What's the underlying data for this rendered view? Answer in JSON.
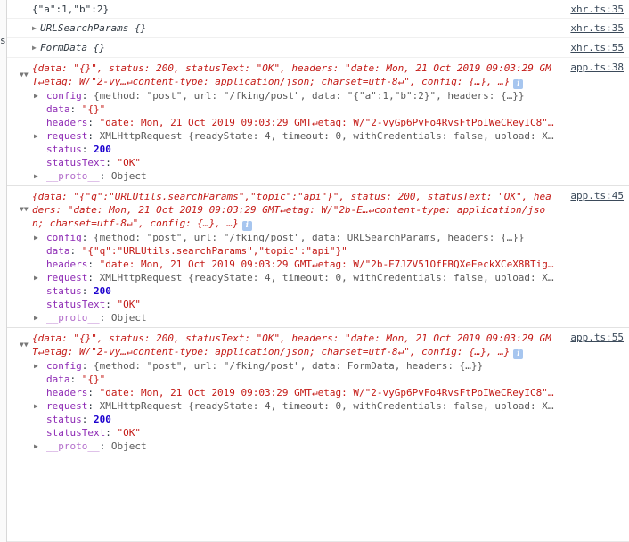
{
  "console": {
    "gutter_fragment": "s",
    "messages": [
      {
        "kind": "plain",
        "text": "{\"a\":1,\"b\":2}",
        "source": "xhr.ts:35"
      },
      {
        "kind": "collapsed-object",
        "text": "URLSearchParams {}",
        "source": "xhr.ts:35"
      },
      {
        "kind": "collapsed-object",
        "text": "FormData {}",
        "source": "xhr.ts:55"
      }
    ],
    "groups": [
      {
        "source": "app.ts:38",
        "preview_line1": "{data: \"{}\", status: 200, statusText: \"OK\", headers: \"date: Mon, 21 Oct 2019 09:03:29 GM",
        "preview_line2": "T↵etag: W/\"2-vy…↵content-type: application/json; charset=utf-8↵\", config: {…}, …}",
        "info_icon": "i",
        "props": [
          {
            "expandable": true,
            "name": "config",
            "sep": ": ",
            "value": "{method: \"post\", url: \"/fking/post\", data: \"{\"a\":1,\"b\":2}\", headers: {…}}",
            "type": "object-preview"
          },
          {
            "expandable": false,
            "name": "data",
            "sep": ": ",
            "value": "\"{}\"",
            "type": "string"
          },
          {
            "expandable": false,
            "name": "headers",
            "sep": ": ",
            "value": "\"date: Mon, 21 Oct 2019 09:03:29 GMT↵etag: W/\"2-vyGp6PvFo4RvsFtPoIWeCReyIC8\"…",
            "type": "string"
          },
          {
            "expandable": true,
            "name": "request",
            "sep": ": ",
            "value": "XMLHttpRequest {readyState: 4, timeout: 0, withCredentials: false, upload: X…",
            "type": "xhr-preview"
          },
          {
            "expandable": false,
            "name": "status",
            "sep": ": ",
            "value": "200",
            "type": "number"
          },
          {
            "expandable": false,
            "name": "statusText",
            "sep": ": ",
            "value": "\"OK\"",
            "type": "string"
          },
          {
            "expandable": true,
            "name": "__proto__",
            "sep": ": ",
            "value": "Object",
            "type": "proto"
          }
        ]
      },
      {
        "source": "app.ts:45",
        "preview_line1": "{data: \"{\"q\":\"URLUtils.searchParams\",\"topic\":\"api\"}\", status: 200, statusText: \"OK\", hea",
        "preview_line2": "ders: \"date: Mon, 21 Oct 2019 09:03:29 GMT↵etag: W/\"2b-E…↵content-type: application/jso",
        "preview_line3": "n; charset=utf-8↵\", config: {…}, …}",
        "info_icon": "i",
        "props": [
          {
            "expandable": true,
            "name": "config",
            "sep": ": ",
            "value": "{method: \"post\", url: \"/fking/post\", data: URLSearchParams, headers: {…}}",
            "type": "object-preview"
          },
          {
            "expandable": false,
            "name": "data",
            "sep": ": ",
            "value": "\"{\"q\":\"URLUtils.searchParams\",\"topic\":\"api\"}\"",
            "type": "string"
          },
          {
            "expandable": false,
            "name": "headers",
            "sep": ": ",
            "value": "\"date: Mon, 21 Oct 2019 09:03:29 GMT↵etag: W/\"2b-E7JZV51OfFBQXeEeckXCeX8BTig…",
            "type": "string"
          },
          {
            "expandable": true,
            "name": "request",
            "sep": ": ",
            "value": "XMLHttpRequest {readyState: 4, timeout: 0, withCredentials: false, upload: X…",
            "type": "xhr-preview"
          },
          {
            "expandable": false,
            "name": "status",
            "sep": ": ",
            "value": "200",
            "type": "number"
          },
          {
            "expandable": false,
            "name": "statusText",
            "sep": ": ",
            "value": "\"OK\"",
            "type": "string"
          },
          {
            "expandable": true,
            "name": "__proto__",
            "sep": ": ",
            "value": "Object",
            "type": "proto"
          }
        ]
      },
      {
        "source": "app.ts:55",
        "preview_line1": "{data: \"{}\", status: 200, statusText: \"OK\", headers: \"date: Mon, 21 Oct 2019 09:03:29 GM",
        "preview_line2": "T↵etag: W/\"2-vy…↵content-type: application/json; charset=utf-8↵\", config: {…}, …}",
        "info_icon": "i",
        "props": [
          {
            "expandable": true,
            "name": "config",
            "sep": ": ",
            "value": "{method: \"post\", url: \"/fking/post\", data: FormData, headers: {…}}",
            "type": "object-preview"
          },
          {
            "expandable": false,
            "name": "data",
            "sep": ": ",
            "value": "\"{}\"",
            "type": "string"
          },
          {
            "expandable": false,
            "name": "headers",
            "sep": ": ",
            "value": "\"date: Mon, 21 Oct 2019 09:03:29 GMT↵etag: W/\"2-vyGp6PvFo4RvsFtPoIWeCReyIC8\"…",
            "type": "string"
          },
          {
            "expandable": true,
            "name": "request",
            "sep": ": ",
            "value": "XMLHttpRequest {readyState: 4, timeout: 0, withCredentials: false, upload: X…",
            "type": "xhr-preview"
          },
          {
            "expandable": false,
            "name": "status",
            "sep": ": ",
            "value": "200",
            "type": "number"
          },
          {
            "expandable": false,
            "name": "statusText",
            "sep": ": ",
            "value": "\"OK\"",
            "type": "string"
          },
          {
            "expandable": true,
            "name": "__proto__",
            "sep": ": ",
            "value": "Object",
            "type": "proto"
          }
        ]
      }
    ],
    "colors": {
      "string": "#c41a16",
      "number": "#1c00cf",
      "property": "#8d29b4",
      "text": "#303942",
      "link": "#3b4a5a",
      "info_badge": "#a7c6ef"
    }
  }
}
